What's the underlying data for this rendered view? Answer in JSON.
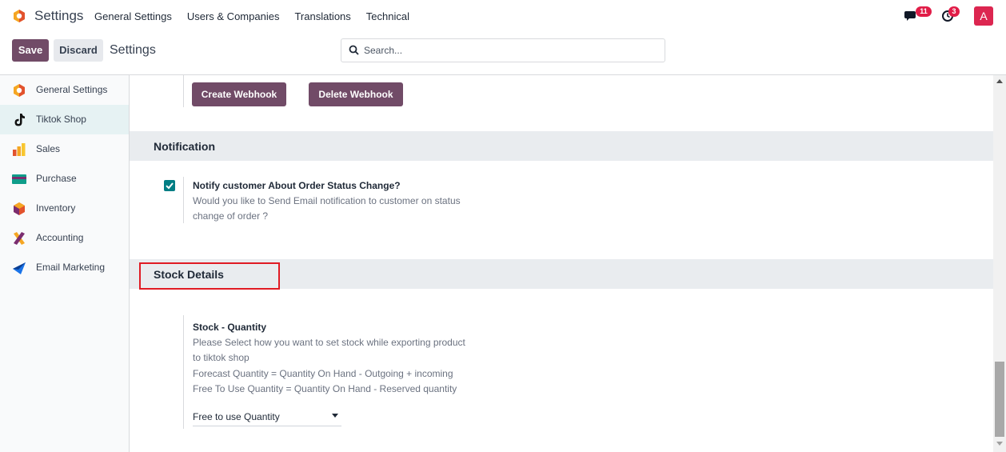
{
  "navbar": {
    "app_title": "Settings",
    "menu": [
      "General Settings",
      "Users & Companies",
      "Translations",
      "Technical"
    ],
    "messages_count": "11",
    "activities_count": "3",
    "avatar_letter": "A"
  },
  "control_panel": {
    "save_label": "Save",
    "discard_label": "Discard",
    "title": "Settings",
    "search_placeholder": "Search..."
  },
  "sidebar": {
    "items": [
      {
        "label": "General Settings",
        "icon": "odoo-logo-icon"
      },
      {
        "label": "Tiktok Shop",
        "icon": "tiktok-icon"
      },
      {
        "label": "Sales",
        "icon": "sales-chart-icon"
      },
      {
        "label": "Purchase",
        "icon": "purchase-card-icon"
      },
      {
        "label": "Inventory",
        "icon": "inventory-box-icon"
      },
      {
        "label": "Accounting",
        "icon": "accounting-icon"
      },
      {
        "label": "Email Marketing",
        "icon": "email-marketing-icon"
      }
    ]
  },
  "main": {
    "create_webhook_label": "Create Webhook",
    "delete_webhook_label": "Delete Webhook",
    "notification": {
      "section_title": "Notification",
      "setting_title": "Notify customer About Order Status Change?",
      "setting_desc_1": "Would you like to Send Email notification to customer on status",
      "setting_desc_2": "change of order ?",
      "checked": true
    },
    "stock": {
      "section_title": "Stock Details",
      "setting_title": "Stock - Quantity",
      "desc_1": "Please Select how you want to set stock while exporting product",
      "desc_2": "to tiktok shop",
      "desc_3": "Forecast Quantity = Quantity On Hand - Outgoing + incoming",
      "desc_4": "Free To Use Quantity = Quantity On Hand - Reserved quantity",
      "selected_option": "Free to use Quantity"
    }
  },
  "colors": {
    "primary": "#714b67",
    "checkbox": "#017e84",
    "highlight": "#e01b24",
    "badge": "#e11d48"
  }
}
